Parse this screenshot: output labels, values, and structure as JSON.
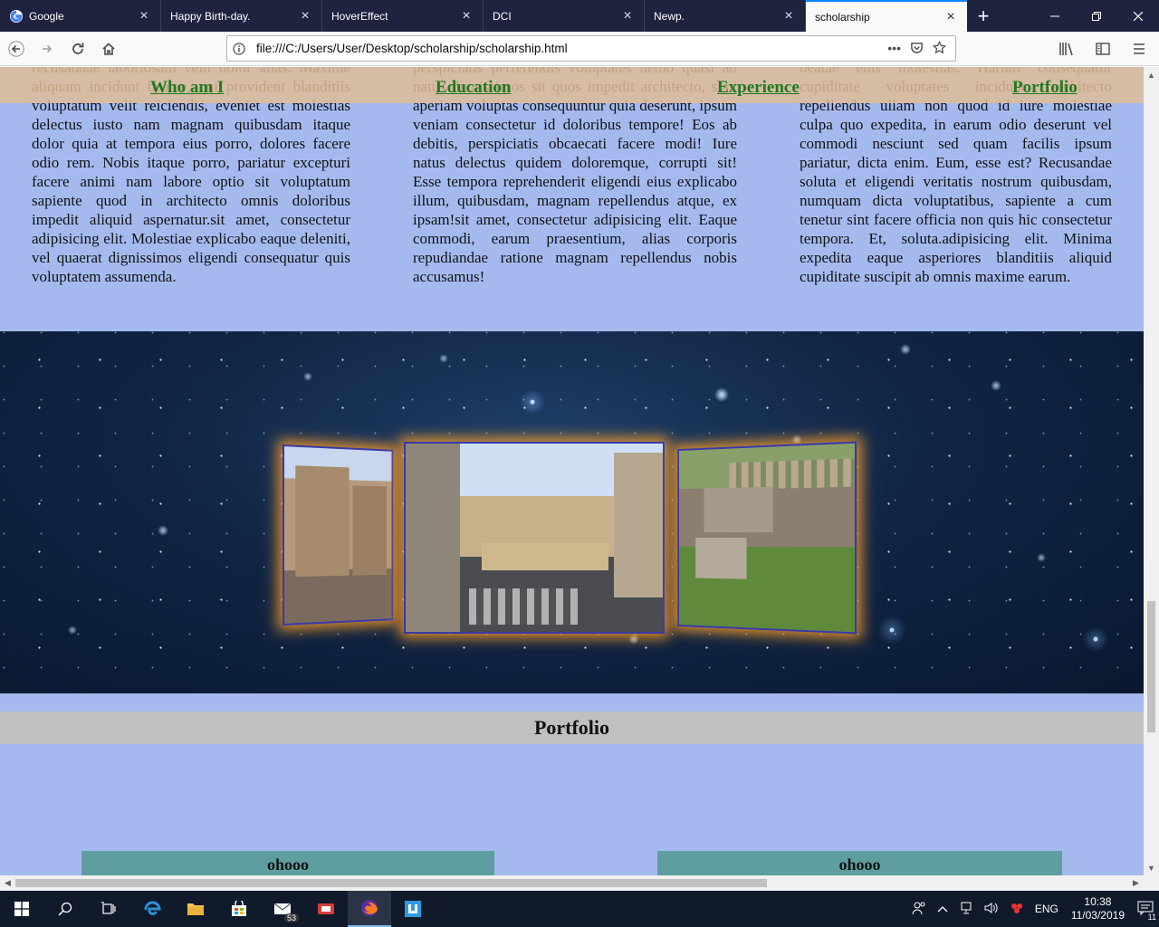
{
  "browser": {
    "tabs": [
      {
        "label": "Google",
        "icon": "google-icon",
        "active": false
      },
      {
        "label": "Happy Birth-day.",
        "icon": "",
        "active": false
      },
      {
        "label": "HoverEffect",
        "icon": "",
        "active": false
      },
      {
        "label": "DCI",
        "icon": "",
        "active": false
      },
      {
        "label": "Newp.",
        "icon": "",
        "active": false
      },
      {
        "label": "scholarship",
        "icon": "",
        "active": true
      }
    ],
    "url": "file:///C:/Users/User/Desktop/scholarship/scholarship.html",
    "accent": "#0a84ff"
  },
  "page": {
    "nav": [
      "Who am I",
      "Education",
      "Experience",
      "Portfolio"
    ],
    "columns": [
      "recusandae laboriosam velit dolor alias. Maxime aliquam incidunt beatae, qui provident blanditiis voluptatum velit reiciendis, eveniet est molestias delectus iusto nam magnam quibusdam itaque dolor quia at tempora eius porro, dolores facere odio rem. Nobis itaque porro, pariatur excepturi facere animi nam labore optio sit voluptatum sapiente quod in architecto omnis doloribus impedit aliquid aspernatur.sit amet, consectetur adipisicing elit. Molestiae explicabo eaque deleniti, vel quaerat dignissimos eligendi consequatur quis voluptatem assumenda.",
      "perspiciatis perferendis voluptates nemo quasi ab natus dignissimos sit quos impedit architecto, sunt aperiam voluptas consequuntur quia deserunt, ipsum veniam consectetur id doloribus tempore! Eos ab debitis, perspiciatis obcaecati facere modi! Iure natus delectus quidem doloremque, corrupti sit! Esse tempora reprehenderit eligendi eius explicabo illum, quibusdam, magnam repellendus atque, ex ipsam!sit amet, consectetur adipisicing elit. Eaque commodi, earum praesentium, alias corporis repudiandae ratione magnam repellendus nobis accusamus!",
      "beatae eius molestias. Harum consequatur cupiditate voluptates incidunt architecto repellendus ullam non quod id iure molestiae culpa quo expedita, in earum odio deserunt vel commodi nesciunt sed quam facilis ipsum pariatur, dicta enim. Eum, esse est? Recusandae soluta et eligendi veritatis nostrum quibusdam, numquam dicta voluptatibus, sapiente a cum tenetur sint facere officia non quis hic consectetur tempora. Et, soluta.adipisicing elit. Minima expedita eaque asperiores blanditiis aliquid cupiditate suscipit ab omnis maxime earum."
    ],
    "portfolio_title": "Portfolio",
    "cards": [
      "ohooo",
      "ohooo"
    ],
    "colors": {
      "background": "#a4baef",
      "nav_link": "#1f7a1f",
      "card": "#5f9ea0",
      "header_band": "#c0c0c0"
    }
  },
  "taskbar": {
    "mail_badge": "53",
    "language": "ENG",
    "time": "10:38",
    "date": "11/03/2019",
    "notifications": "11"
  }
}
